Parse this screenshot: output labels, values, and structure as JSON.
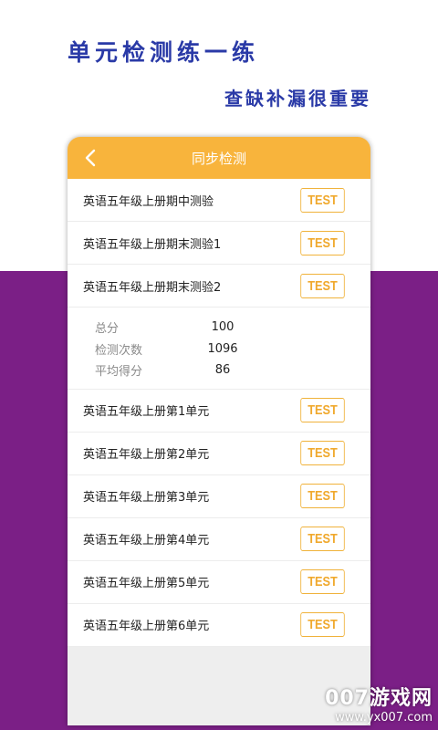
{
  "promo": {
    "headline": "单元检测练一练",
    "subline": "查缺补漏很重要"
  },
  "colors": {
    "brand_orange": "#f8b43c",
    "purple_bg": "#7b1f86",
    "headline_blue": "#2a3aa7"
  },
  "header": {
    "back_icon": "chevron-left-icon",
    "title": "同步检测"
  },
  "tests": [
    {
      "label": "英语五年级上册期中测验",
      "button": "TEST"
    },
    {
      "label": "英语五年级上册期末测验1",
      "button": "TEST"
    },
    {
      "label": "英语五年级上册期末测验2",
      "button": "TEST"
    }
  ],
  "stats": [
    {
      "label": "总分",
      "value": "100"
    },
    {
      "label": "检测次数",
      "value": "1096"
    },
    {
      "label": "平均得分",
      "value": "86"
    }
  ],
  "units": [
    {
      "label": "英语五年级上册第1单元",
      "button": "TEST"
    },
    {
      "label": "英语五年级上册第2单元",
      "button": "TEST"
    },
    {
      "label": "英语五年级上册第3单元",
      "button": "TEST"
    },
    {
      "label": "英语五年级上册第4单元",
      "button": "TEST"
    },
    {
      "label": "英语五年级上册第5单元",
      "button": "TEST"
    },
    {
      "label": "英语五年级上册第6单元",
      "button": "TEST"
    }
  ],
  "watermark": {
    "brand": "007游戏网",
    "url": "www.yx007.com"
  }
}
